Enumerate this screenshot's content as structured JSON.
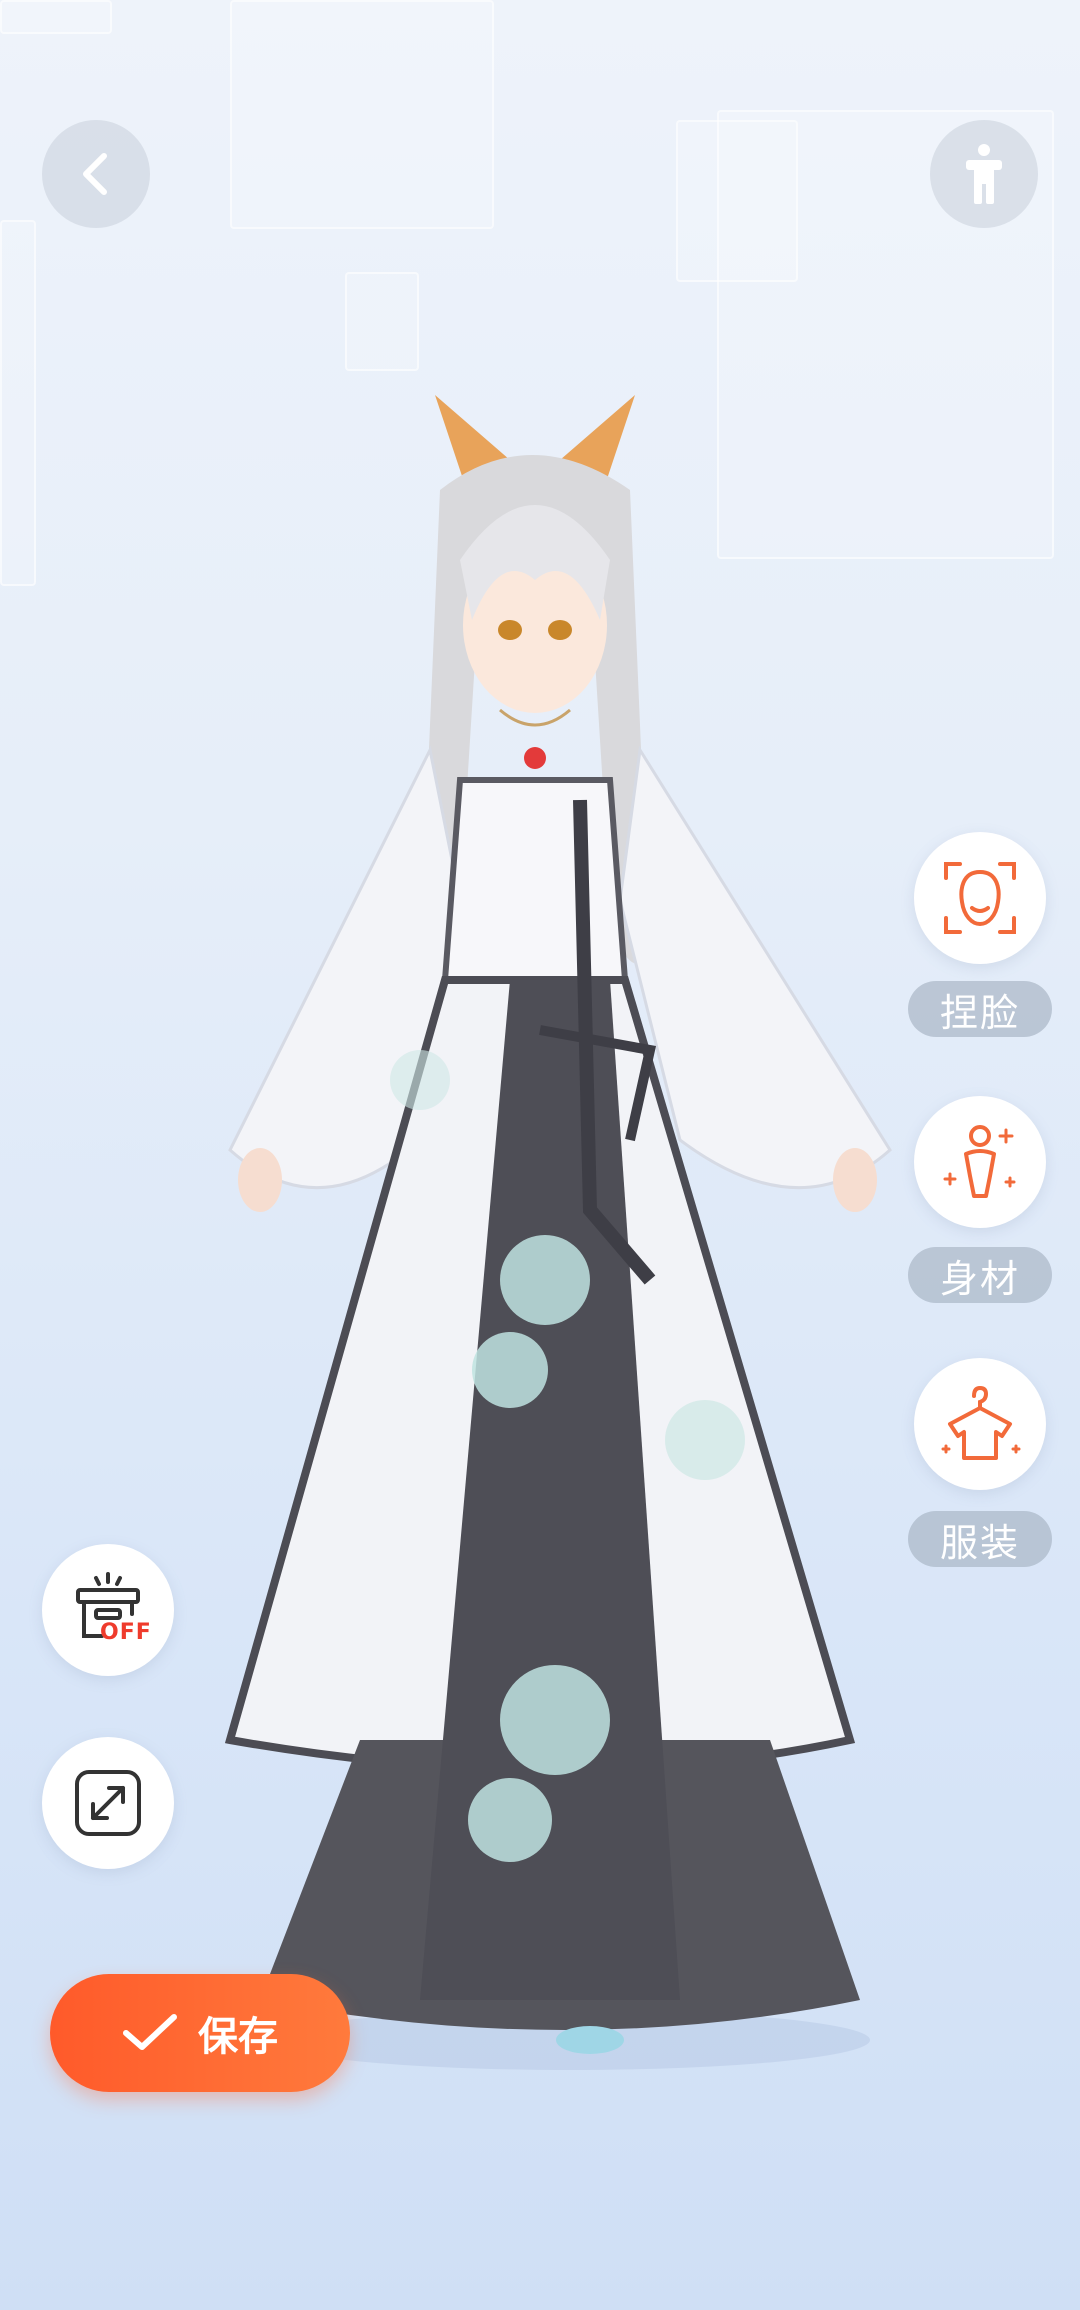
{
  "toolbar": {
    "back_icon": "chevron-left-icon",
    "body_toggle_icon": "person-standing-icon"
  },
  "side_menu": {
    "items": [
      {
        "label": "捏脸",
        "icon": "face-icon"
      },
      {
        "label": "身材",
        "icon": "body-icon"
      },
      {
        "label": "服装",
        "icon": "clothes-hanger-icon"
      }
    ]
  },
  "left_tools": {
    "background_toggle_label": "OFF",
    "background_toggle_icon": "stage-off-icon",
    "fullscreen_icon": "expand-icon"
  },
  "save": {
    "label": "保存",
    "icon": "check-icon"
  },
  "colors": {
    "accent": "#ff6a33",
    "icon_orange": "#f26a3a",
    "off_red": "#ef3b2c",
    "label_bg": "#aab6c6"
  }
}
